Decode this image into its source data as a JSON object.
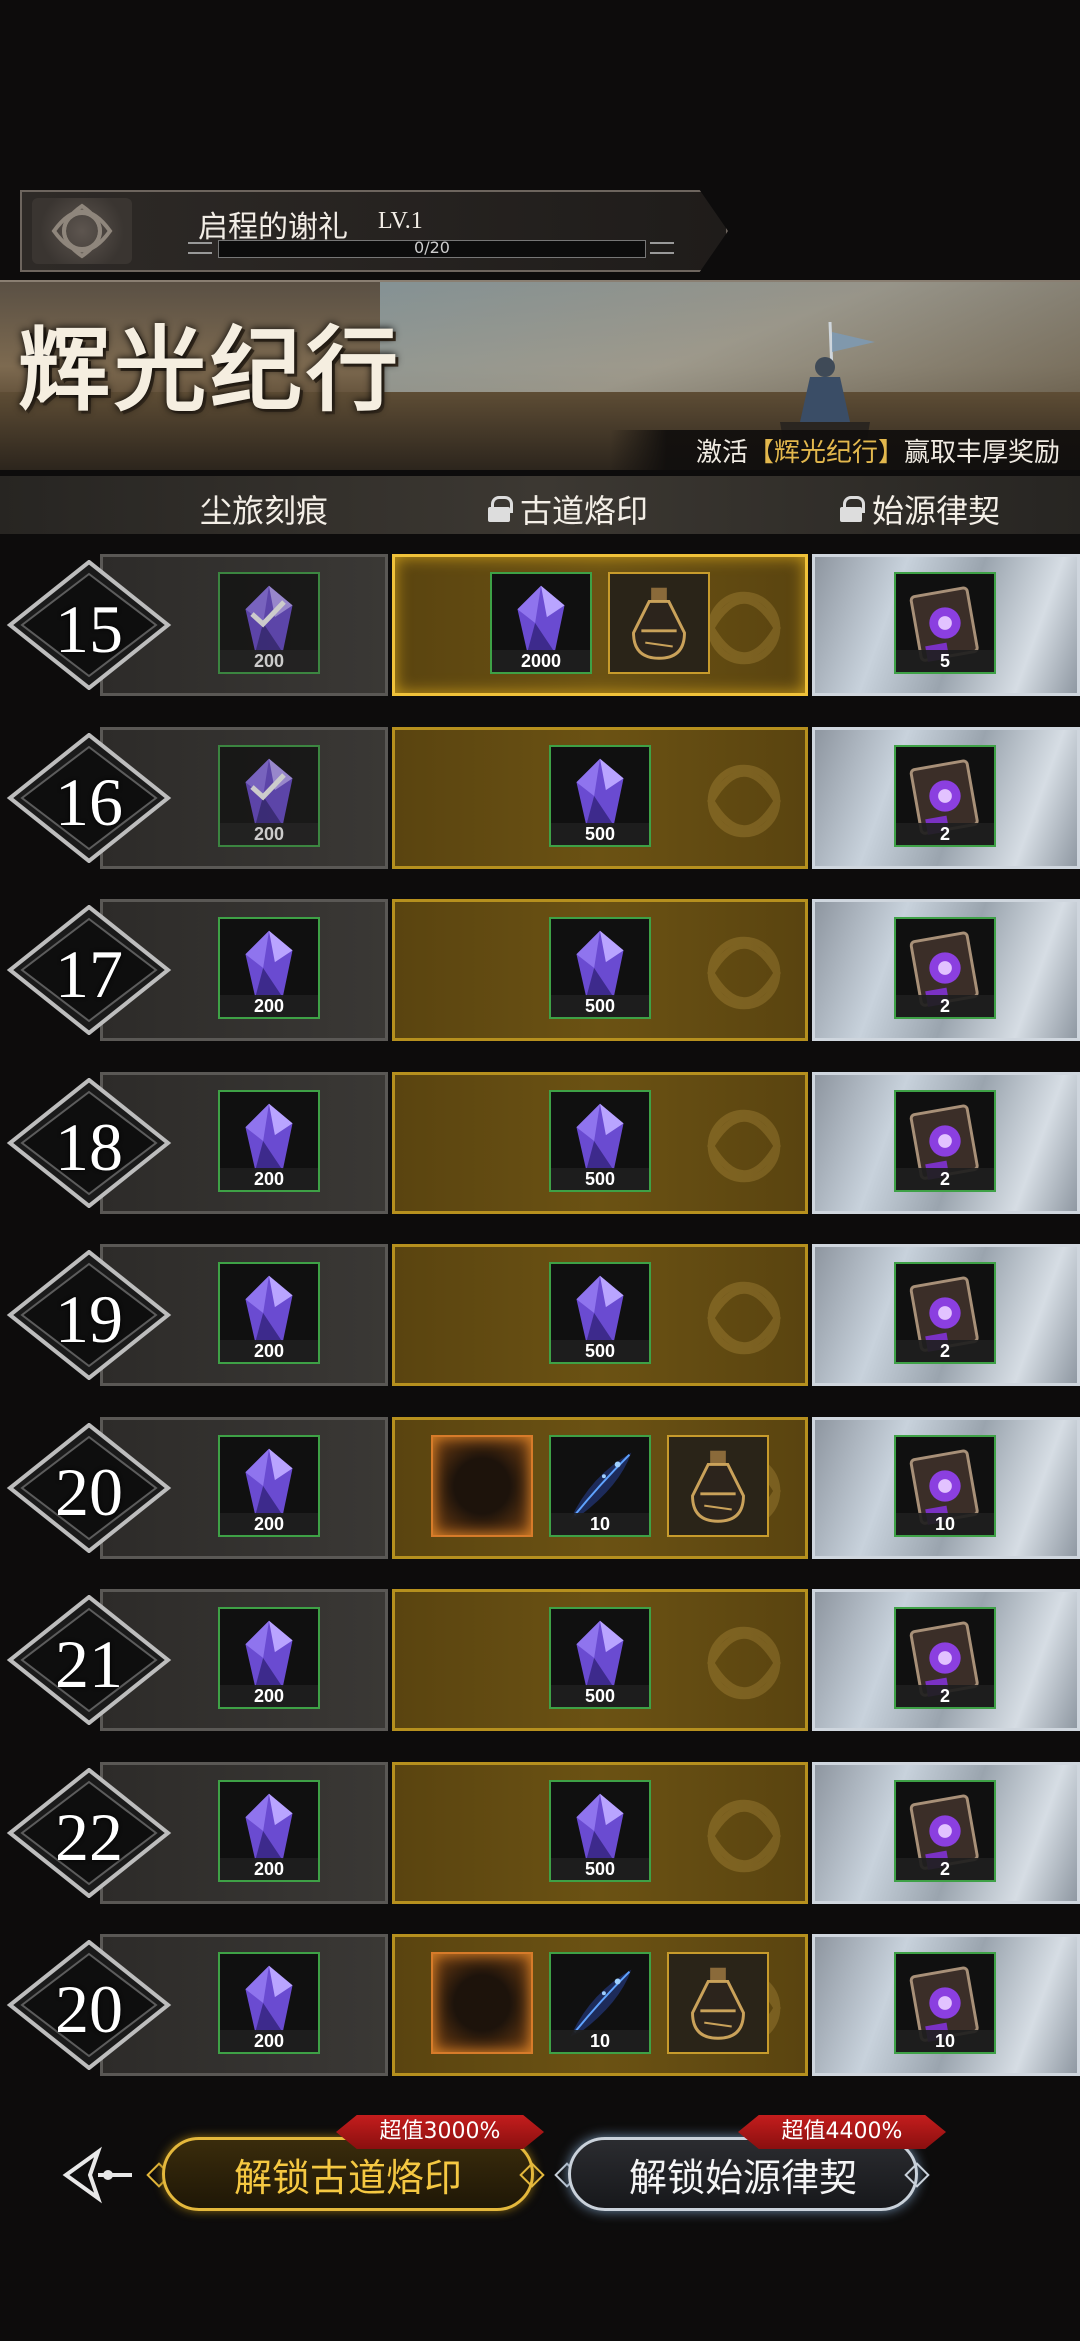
{
  "header": {
    "title": "启程的谢礼",
    "level": "LV.1",
    "progress_text": "0/20",
    "progress": 0.0
  },
  "banner": {
    "title": "辉光纪行",
    "ribbon_prefix": "激活",
    "ribbon_highlight": "【辉光纪行】",
    "ribbon_suffix": "赢取丰厚奖励"
  },
  "columns": {
    "free": "尘旅刻痕",
    "premium": "古道烙印",
    "elite": "始源律契"
  },
  "rows": [
    {
      "level": "15",
      "free": {
        "icon": "purple-crystal",
        "qty": "200",
        "claimed": true
      },
      "premium": [
        {
          "icon": "purple-crystal",
          "qty": "2000"
        },
        {
          "icon": "potion-bottle",
          "qty": ""
        }
      ],
      "elite": {
        "icon": "purple-tome",
        "qty": "5"
      }
    },
    {
      "level": "16",
      "free": {
        "icon": "purple-crystal",
        "qty": "200",
        "claimed": true
      },
      "premium": [
        {
          "icon": "purple-crystal",
          "qty": "500"
        }
      ],
      "elite": {
        "icon": "purple-tome",
        "qty": "2"
      }
    },
    {
      "level": "17",
      "free": {
        "icon": "purple-crystal",
        "qty": "200",
        "claimed": false
      },
      "premium": [
        {
          "icon": "purple-crystal",
          "qty": "500"
        }
      ],
      "elite": {
        "icon": "purple-tome",
        "qty": "2"
      }
    },
    {
      "level": "18",
      "free": {
        "icon": "purple-crystal",
        "qty": "200",
        "claimed": false
      },
      "premium": [
        {
          "icon": "purple-crystal",
          "qty": "500"
        }
      ],
      "elite": {
        "icon": "purple-tome",
        "qty": "2"
      }
    },
    {
      "level": "19",
      "free": {
        "icon": "purple-crystal",
        "qty": "200",
        "claimed": false
      },
      "premium": [
        {
          "icon": "purple-crystal",
          "qty": "500"
        }
      ],
      "elite": {
        "icon": "purple-tome",
        "qty": "2"
      }
    },
    {
      "level": "20",
      "free": {
        "icon": "purple-crystal",
        "qty": "200",
        "claimed": false
      },
      "premium": [
        {
          "icon": "fiery-frame",
          "qty": ""
        },
        {
          "icon": "blue-feather",
          "qty": "10"
        },
        {
          "icon": "potion-bottle",
          "qty": ""
        }
      ],
      "elite": {
        "icon": "purple-tome",
        "qty": "10"
      }
    },
    {
      "level": "21",
      "free": {
        "icon": "purple-crystal",
        "qty": "200",
        "claimed": false
      },
      "premium": [
        {
          "icon": "purple-crystal",
          "qty": "500"
        }
      ],
      "elite": {
        "icon": "purple-tome",
        "qty": "2"
      }
    },
    {
      "level": "22",
      "free": {
        "icon": "purple-crystal",
        "qty": "200",
        "claimed": false
      },
      "premium": [
        {
          "icon": "purple-crystal",
          "qty": "500"
        }
      ],
      "elite": {
        "icon": "purple-tome",
        "qty": "2"
      }
    },
    {
      "level": "20",
      "free": {
        "icon": "purple-crystal",
        "qty": "200",
        "claimed": false
      },
      "premium": [
        {
          "icon": "fiery-frame",
          "qty": ""
        },
        {
          "icon": "blue-feather",
          "qty": "10"
        },
        {
          "icon": "potion-bottle",
          "qty": ""
        }
      ],
      "elite": {
        "icon": "purple-tome",
        "qty": "10"
      }
    }
  ],
  "bottom": {
    "unlock_premium": "解锁古道烙印",
    "unlock_elite": "解锁始源律契",
    "badge_premium": "超值3000%",
    "badge_elite": "超值4400%"
  },
  "colors": {
    "gold": "#e4b83c",
    "premium_bg": "#6b5213",
    "elite_bg": "#c8d2dc",
    "item_border": "#3ea146"
  }
}
